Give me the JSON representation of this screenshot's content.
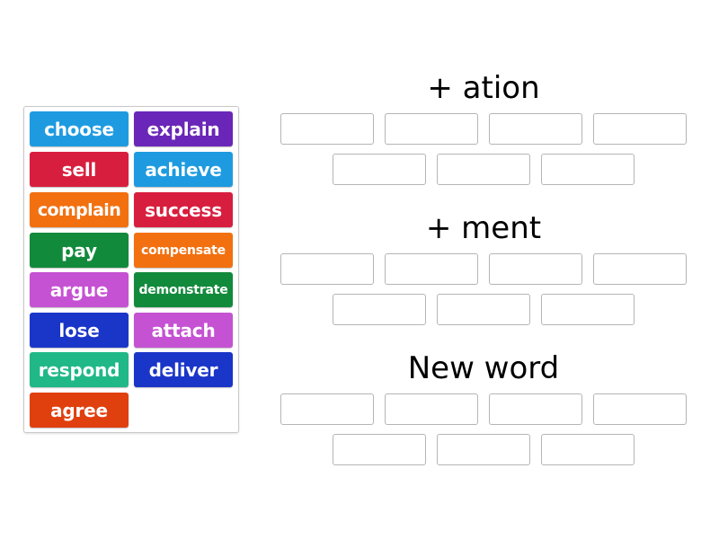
{
  "word_bank": {
    "tiles": [
      {
        "label": "choose",
        "color": "#1e9be0"
      },
      {
        "label": "explain",
        "color": "#6a26b8"
      },
      {
        "label": "sell",
        "color": "#d81e3e"
      },
      {
        "label": "achieve",
        "color": "#1e9be0"
      },
      {
        "label": "complain",
        "color": "#f27010"
      },
      {
        "label": "success",
        "color": "#d81e3e"
      },
      {
        "label": "pay",
        "color": "#128a3c"
      },
      {
        "label": "compensate",
        "color": "#f27010"
      },
      {
        "label": "argue",
        "color": "#c552d2"
      },
      {
        "label": "demonstrate",
        "color": "#128a3c"
      },
      {
        "label": "lose",
        "color": "#1a36c8"
      },
      {
        "label": "attach",
        "color": "#c552d2"
      },
      {
        "label": "respond",
        "color": "#1fb886"
      },
      {
        "label": "deliver",
        "color": "#1a36c8"
      },
      {
        "label": "agree",
        "color": "#e0400e"
      }
    ]
  },
  "groups": [
    {
      "title": "+ ation",
      "slots": 7
    },
    {
      "title": "+ ment",
      "slots": 7
    },
    {
      "title": "New word",
      "slots": 7
    }
  ]
}
